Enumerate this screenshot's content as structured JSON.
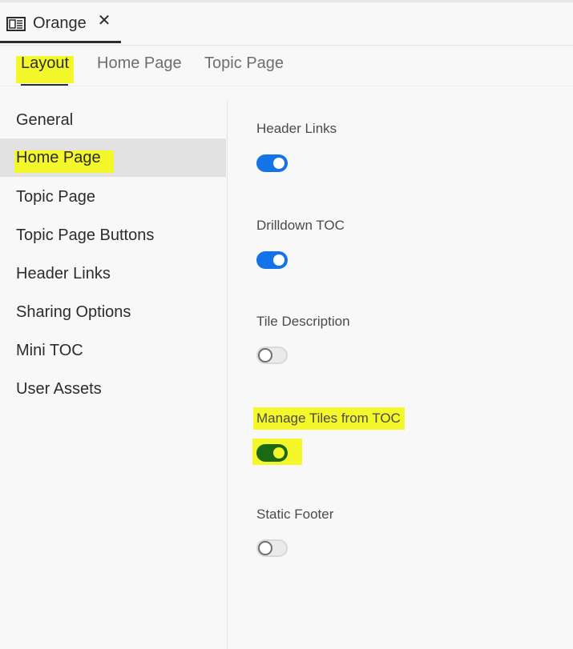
{
  "file_tab": {
    "title": "Orange",
    "icon": "document-icon",
    "close_glyph": "✕"
  },
  "tabs": [
    {
      "label": "Layout",
      "active": true,
      "highlighted": true
    },
    {
      "label": "Home Page",
      "active": false
    },
    {
      "label": "Topic Page",
      "active": false
    }
  ],
  "sidebar": {
    "items": [
      {
        "label": "General"
      },
      {
        "label": "Home Page",
        "active": true,
        "highlighted": true
      },
      {
        "label": "Topic Page"
      },
      {
        "label": "Topic Page Buttons"
      },
      {
        "label": "Header Links"
      },
      {
        "label": "Sharing Options"
      },
      {
        "label": "Mini TOC"
      },
      {
        "label": "User Assets"
      }
    ]
  },
  "settings": [
    {
      "label": "Header Links",
      "enabled": true
    },
    {
      "label": "Drilldown TOC",
      "enabled": true
    },
    {
      "label": "Tile Description",
      "enabled": false
    },
    {
      "label": "Manage Tiles from TOC",
      "enabled": true,
      "highlighted": true
    },
    {
      "label": "Static Footer",
      "enabled": false
    }
  ],
  "colors": {
    "toggle_on": "#1473e6",
    "toggle_on_highlighted": "#1b6a13",
    "highlight": "#f4f72a",
    "selected_item_bg": "#e2e2e2"
  }
}
